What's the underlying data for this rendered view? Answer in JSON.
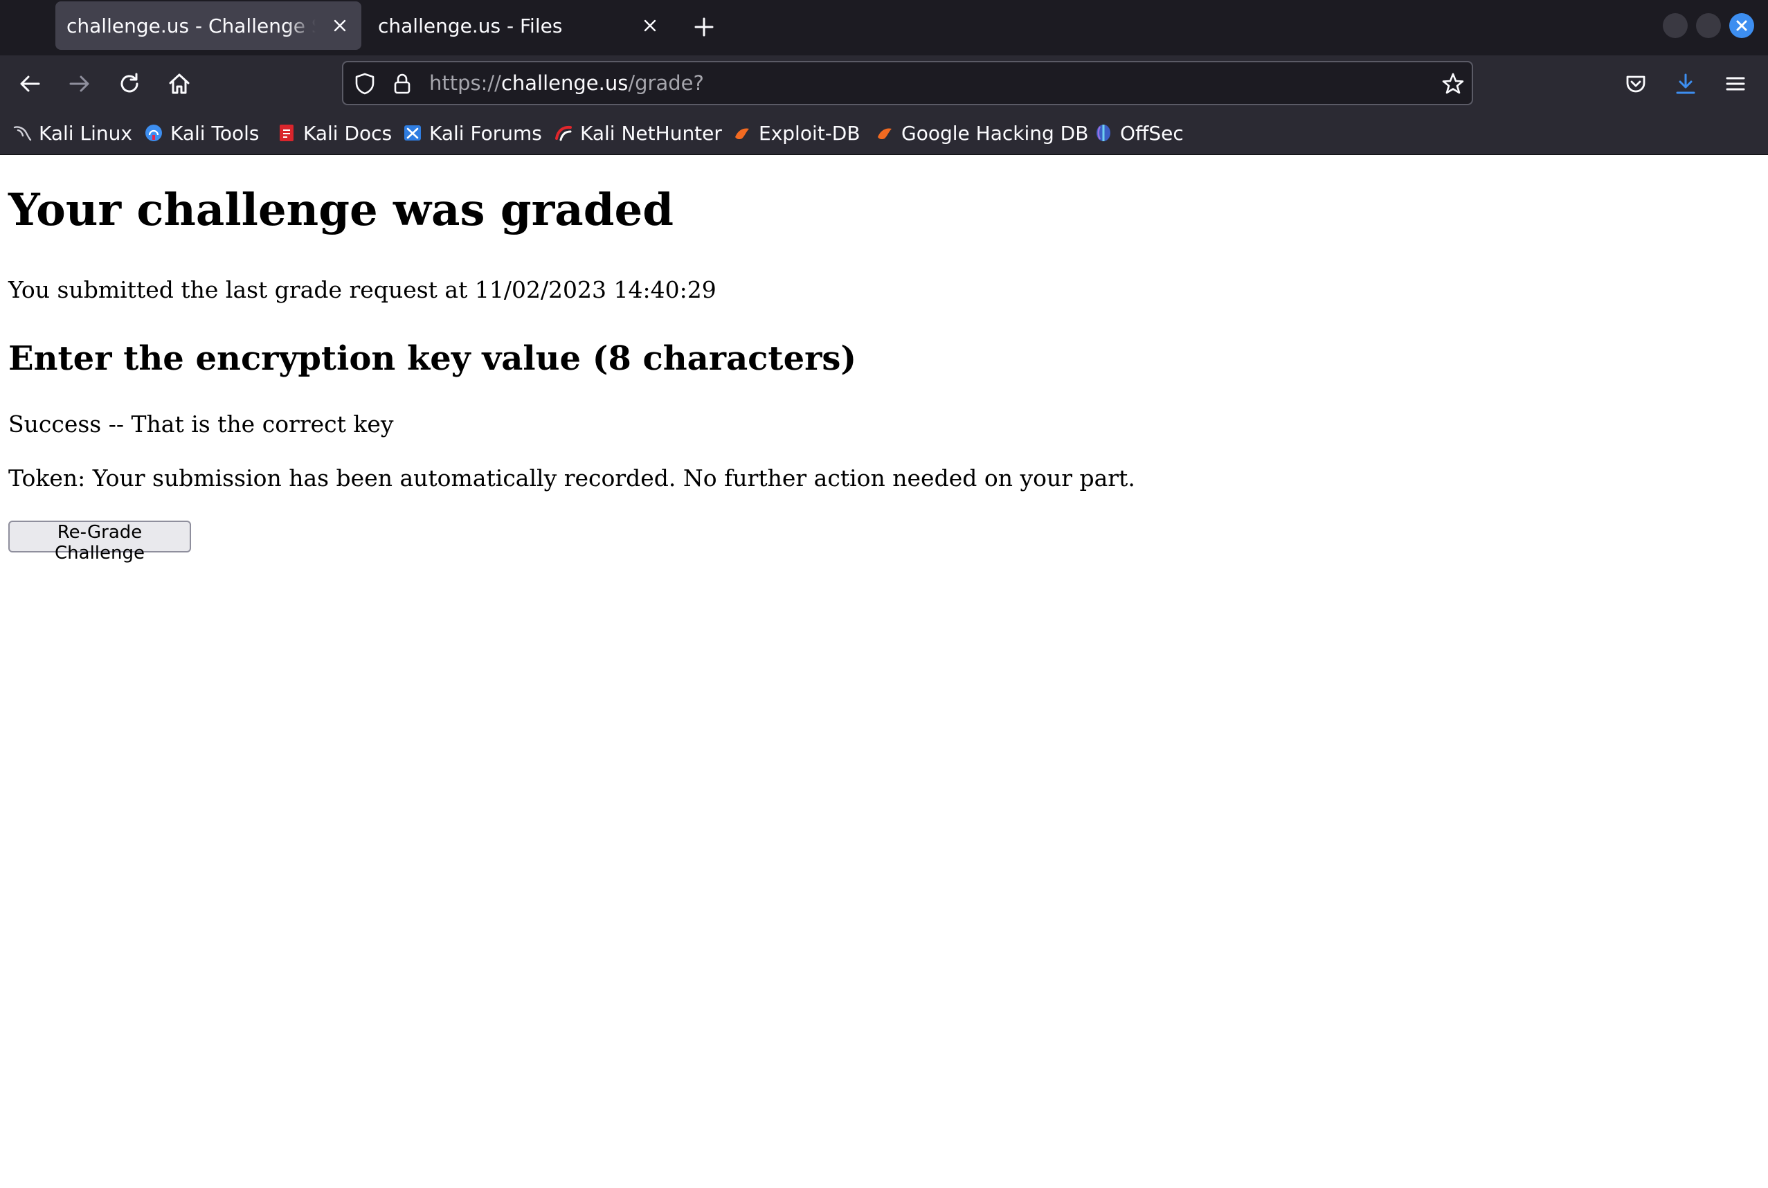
{
  "browser": {
    "tabs": [
      {
        "title": "challenge.us - Challenge Success",
        "active": true
      },
      {
        "title": "challenge.us - Files",
        "active": false
      }
    ],
    "address": {
      "scheme": "https://",
      "host": "challenge.us",
      "path": "/grade?"
    },
    "bookmarks": [
      {
        "label": "Kali Linux",
        "icon": "kali-dragon-icon"
      },
      {
        "label": "Kali Tools",
        "icon": "kali-tools-icon"
      },
      {
        "label": "Kali Docs",
        "icon": "kali-docs-icon"
      },
      {
        "label": "Kali Forums",
        "icon": "kali-forums-icon"
      },
      {
        "label": "Kali NetHunter",
        "icon": "nethunter-icon"
      },
      {
        "label": "Exploit-DB",
        "icon": "exploit-db-icon"
      },
      {
        "label": "Google Hacking DB",
        "icon": "ghdb-icon"
      },
      {
        "label": "OffSec",
        "icon": "offsec-icon"
      }
    ],
    "colors": {
      "tabstrip_bg": "#1c1b22",
      "toolbar_bg": "#2b2a33",
      "active_tab_bg": "#42414d",
      "accent_blue": "#3d8ef0"
    }
  },
  "page": {
    "heading": "Your challenge was graded",
    "submitted_text": "You submitted the last grade request at 11/02/2023 14:40:29",
    "question": "Enter the encryption key value (8 characters)",
    "result": "Success -- That is the correct key",
    "token": "Token: Your submission has been automatically recorded. No further action needed on your part.",
    "regrade_label": "Re-Grade Challenge"
  }
}
